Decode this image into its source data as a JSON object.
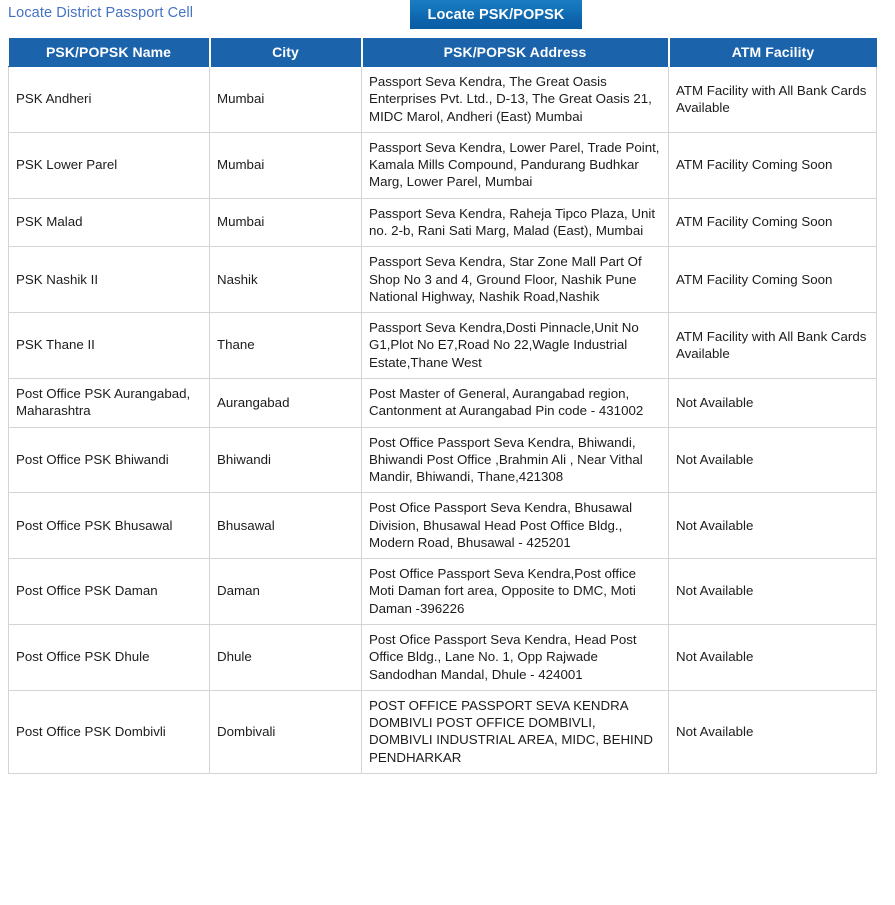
{
  "header": {
    "district_link_label": "Locate District Passport Cell",
    "active_tab_label": "Locate PSK/POPSK",
    "link_color": "#4472c4",
    "tab_color": "#0d63ab"
  },
  "table": {
    "header_bg": "#1b63ab",
    "columns": [
      "PSK/POPSK Name",
      "City",
      "PSK/POPSK Address",
      "ATM Facility"
    ],
    "rows": [
      {
        "name": "PSK Andheri",
        "city": "Mumbai",
        "address": "Passport Seva Kendra, The Great Oasis Enterprises Pvt. Ltd., D-13, The Great Oasis 21, MIDC Marol, Andheri (East) Mumbai",
        "atm": "ATM Facility with All Bank Cards Available"
      },
      {
        "name": "PSK Lower Parel",
        "city": "Mumbai",
        "address": "Passport Seva Kendra, Lower Parel, Trade Point, Kamala Mills Compound, Pandurang Budhkar Marg, Lower Parel, Mumbai",
        "atm": "ATM Facility Coming Soon"
      },
      {
        "name": "PSK Malad",
        "city": "Mumbai",
        "address": "Passport Seva Kendra, Raheja Tipco Plaza, Unit no. 2-b, Rani Sati Marg, Malad (East), Mumbai",
        "atm": "ATM Facility Coming Soon"
      },
      {
        "name": "PSK Nashik II",
        "city": "Nashik",
        "address": "Passport Seva Kendra, Star Zone Mall Part Of Shop No 3 and 4, Ground Floor, Nashik Pune National Highway, Nashik Road,Nashik",
        "atm": "ATM Facility Coming Soon"
      },
      {
        "name": "PSK Thane II",
        "city": "Thane",
        "address": "Passport Seva Kendra,Dosti Pinnacle,Unit No G1,Plot No E7,Road No 22,Wagle Industrial Estate,Thane West",
        "atm": "ATM Facility with All Bank Cards Available"
      },
      {
        "name": "Post Office PSK Aurangabad, Maharashtra",
        "city": "Aurangabad",
        "address": "Post Master of General, Aurangabad region, Cantonment at Aurangabad Pin code - 431002",
        "atm": "Not Available"
      },
      {
        "name": "Post Office PSK Bhiwandi",
        "city": "Bhiwandi",
        "address": "Post Office Passport Seva Kendra, Bhiwandi, Bhiwandi Post Office ,Brahmin Ali , Near Vithal Mandir, Bhiwandi, Thane,421308",
        "atm": "Not Available"
      },
      {
        "name": "Post Office PSK Bhusawal",
        "city": "Bhusawal",
        "address": "Post Ofice Passport Seva Kendra, Bhusawal Division, Bhusawal Head Post Office Bldg., Modern Road, Bhusawal - 425201",
        "atm": "Not Available"
      },
      {
        "name": "Post Office PSK Daman",
        "city": "Daman",
        "address": "Post Office Passport Seva Kendra,Post office Moti Daman fort area, Opposite to DMC, Moti Daman -396226",
        "atm": "Not Available"
      },
      {
        "name": "Post Office PSK Dhule",
        "city": "Dhule",
        "address": "Post Ofice Passport Seva Kendra, Head Post Office Bldg., Lane No. 1, Opp Rajwade Sandodhan Mandal, Dhule - 424001",
        "atm": "Not Available"
      },
      {
        "name": "Post Office PSK Dombivli",
        "city": "Dombivali",
        "address": "POST OFFICE PASSPORT SEVA KENDRA DOMBIVLI POST OFFICE DOMBIVLI, DOMBIVLI INDUSTRIAL AREA, MIDC, BEHIND PENDHARKAR",
        "atm": "Not Available"
      }
    ]
  }
}
